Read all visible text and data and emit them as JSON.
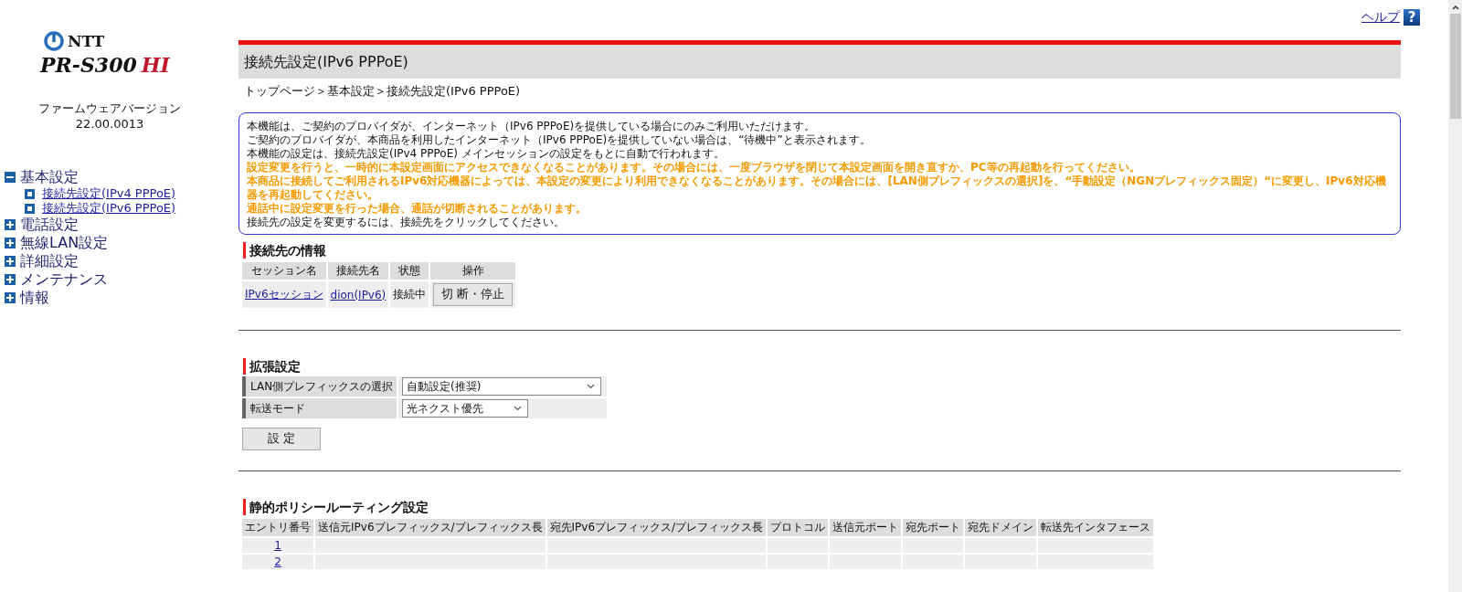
{
  "help": {
    "label": "ヘルプ",
    "icon": "?"
  },
  "logo": {
    "brand": "NTT",
    "model": "PR-S300",
    "model_suffix": "HI"
  },
  "firmware": {
    "label": "ファームウェアバージョン",
    "version": "22.00.0013"
  },
  "sidebar": {
    "items": [
      {
        "label": "基本設定",
        "expanded": true,
        "children": [
          {
            "label": "接続先設定(IPv4 PPPoE)"
          },
          {
            "label": "接続先設定(IPv6 PPPoE)"
          }
        ]
      },
      {
        "label": "電話設定",
        "expanded": false
      },
      {
        "label": "無線LAN設定",
        "expanded": false
      },
      {
        "label": "詳細設定",
        "expanded": false
      },
      {
        "label": "メンテナンス",
        "expanded": false
      },
      {
        "label": "情報",
        "expanded": false
      }
    ]
  },
  "page_title": "接続先設定(IPv6 PPPoE)",
  "breadcrumb": "トップページ＞基本設定＞接続先設定(IPv6 PPPoE)",
  "notice": [
    {
      "kind": "normal",
      "text": "本機能は、ご契約のプロバイダが、インターネット（IPv6 PPPoE)を提供している場合にのみご利用いただけます。"
    },
    {
      "kind": "normal",
      "text": "ご契約のプロバイダが、本商品を利用したインターネット（IPv6 PPPoE)を提供していない場合は、“待機中”と表示されます。"
    },
    {
      "kind": "normal",
      "text": "本機能の設定は、接続先設定(IPv4 PPPoE) メインセッションの設定をもとに自動で行われます。"
    },
    {
      "kind": "warning",
      "text": "設定変更を行うと、一時的に本設定画面にアクセスできなくなることがあります。その場合には、一度ブラウザを閉じて本設定画面を開き直すか、PC等の再起動を行ってください。"
    },
    {
      "kind": "warning",
      "text": "本商品に接続してご利用されるIPv6対応機器によっては、本設定の変更により利用できなくなることがあります。その場合には、[LAN側プレフィックスの選択]を、“手動設定（NGNプレフィックス固定）“に変更し、IPv6対応機器を再起動してください。"
    },
    {
      "kind": "warning",
      "text": "通話中に設定変更を行った場合、通話が切断されることがあります。"
    },
    {
      "kind": "normal",
      "text": "接続先の設定を変更するには、接続先をクリックしてください。"
    }
  ],
  "connection_info": {
    "heading": "接続先の情報",
    "columns": [
      "セッション名",
      "接続先名",
      "状態",
      "操作"
    ],
    "rows": [
      {
        "session": "IPv6セッション",
        "destination": "dion(IPv6)",
        "status": "接続中",
        "action": "切 断・停止"
      }
    ]
  },
  "extended": {
    "heading": "拡張設定",
    "fields": [
      {
        "label": "LAN側プレフィックスの選択",
        "value": "自動設定(推奨)",
        "wide": true
      },
      {
        "label": "転送モード",
        "value": "光ネクスト優先",
        "wide": false
      }
    ],
    "submit": "設 定"
  },
  "policy_routing": {
    "heading": "静的ポリシールーティング設定",
    "columns": [
      "エントリ番号",
      "送信元IPv6プレフィックス/プレフィックス長",
      "宛先IPv6プレフィックス/プレフィックス長",
      "プロトコル",
      "送信元ポート",
      "宛先ポート",
      "宛先ドメイン",
      "転送先インタフェース"
    ],
    "rows": [
      {
        "entry": "1"
      },
      {
        "entry": "2"
      }
    ]
  }
}
